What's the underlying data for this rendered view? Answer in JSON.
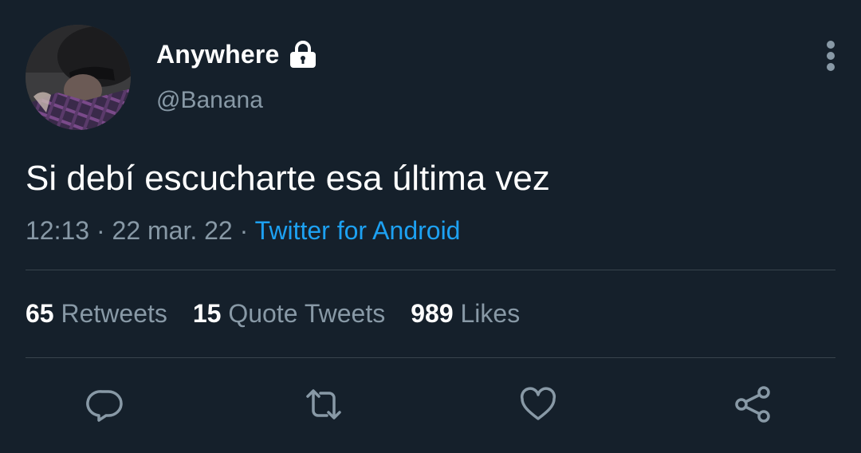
{
  "user": {
    "display_name": "Anywhere",
    "handle": "@Banana",
    "avatar_icon": "avatar-photo",
    "protected_icon": "lock-icon"
  },
  "tweet": {
    "text": "Si debí escucharte esa última vez",
    "time": "12:13",
    "separator": "·",
    "date": "22 mar. 22",
    "source": "Twitter for Android"
  },
  "stats": {
    "retweets_count": "65",
    "retweets_label": "Retweets",
    "quotes_count": "15",
    "quotes_label": "Quote Tweets",
    "likes_count": "989",
    "likes_label": "Likes"
  },
  "actions": [
    {
      "icon": "reply-icon"
    },
    {
      "icon": "retweet-icon"
    },
    {
      "icon": "like-icon"
    },
    {
      "icon": "share-icon"
    }
  ],
  "colors": {
    "background": "#15202b",
    "secondary_text": "#8899a6",
    "link": "#1da1f2",
    "divider": "#38444d"
  }
}
